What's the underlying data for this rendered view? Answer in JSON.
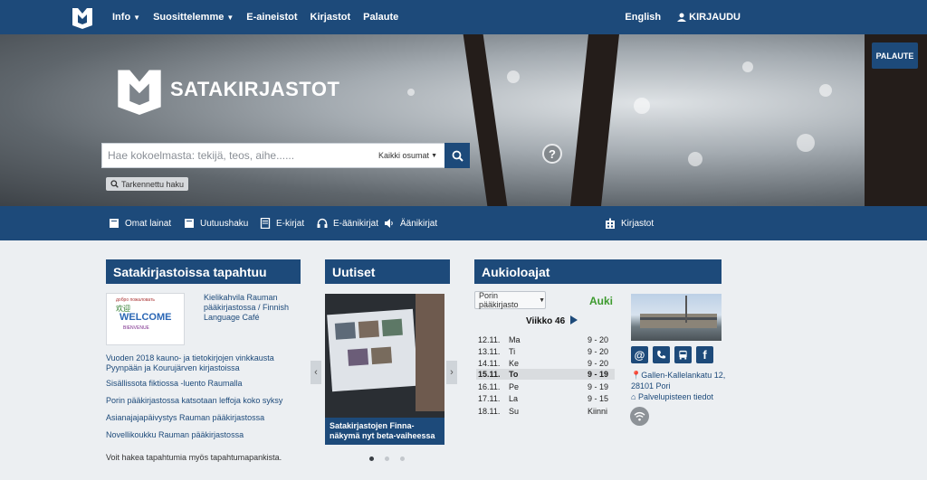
{
  "topbar": {
    "logo_icon": "satakirjastot-logo-icon",
    "nav": [
      {
        "label": "Info",
        "has_dropdown": true
      },
      {
        "label": "Suosittelemme",
        "has_dropdown": true
      },
      {
        "label": "E-aineistot",
        "has_dropdown": false
      },
      {
        "label": "Kirjastot",
        "has_dropdown": false
      },
      {
        "label": "Palaute",
        "has_dropdown": false
      }
    ],
    "language": "English",
    "login": "KIRJAUDU"
  },
  "hero": {
    "brand": "SATAKIRJASTOT",
    "search_placeholder": "Hae kokoelmasta: tekijä, teos, aihe......",
    "search_scope": "Kaikki osumat",
    "advanced_search": "Tarkennettu haku",
    "help": "?",
    "feedback_tab": "PALAUTE"
  },
  "quicklinks": [
    {
      "label": "Omat lainat",
      "icon": "book-icon"
    },
    {
      "label": "Uutuushaku",
      "icon": "book-icon"
    },
    {
      "label": "E-kirjat",
      "icon": "ebook-icon"
    },
    {
      "label": "E-äänikirjat",
      "icon": "headphones-icon"
    },
    {
      "label": "Äänikirjat",
      "icon": "speaker-icon"
    },
    {
      "label": "Kirjastot",
      "icon": "building-icon"
    }
  ],
  "events": {
    "heading": "Satakirjastoissa tapahtuu",
    "featured": "Kielikahvila Rauman pääkirjastossa / Finnish Language Café",
    "image_words": [
      "WELCOME",
      "欢迎",
      "BIENVENUE",
      "добро пожаловать"
    ],
    "items": [
      "Vuoden 2018 kauno- ja tietokirjojen vinkkausta Pyynpään ja Kourujärven kirjastoissa",
      "Sisällissota fiktiossa -luento Raumalla",
      "Porin pääkirjastossa katsotaan leffoja koko syksy",
      "Asianajajapäivystys Rauman pääkirjastossa",
      "Novellikoukku Rauman pääkirjastossa"
    ],
    "footer": "Voit hakea tapahtumia myös tapahtumapankista."
  },
  "news": {
    "heading": "Uutiset",
    "caption": "Satakirjastojen Finna-näkymä nyt beta-vaiheessa",
    "prev": "‹",
    "next": "›"
  },
  "hours": {
    "heading": "Aukioloajat",
    "library": "Porin pääkirjasto",
    "status": "Auki",
    "week": "Viikko 46",
    "rows": [
      {
        "date": "12.11.",
        "day": "Ma",
        "time": "9 - 20",
        "today": false
      },
      {
        "date": "13.11.",
        "day": "Ti",
        "time": "9 - 20",
        "today": false
      },
      {
        "date": "14.11.",
        "day": "Ke",
        "time": "9 - 20",
        "today": false
      },
      {
        "date": "15.11.",
        "day": "To",
        "time": "9 - 19",
        "today": true
      },
      {
        "date": "16.11.",
        "day": "Pe",
        "time": "9 - 19",
        "today": false
      },
      {
        "date": "17.11.",
        "day": "La",
        "time": "9 - 15",
        "today": false
      },
      {
        "date": "18.11.",
        "day": "Su",
        "time": "Kiinni",
        "today": false
      }
    ],
    "contacts": [
      "email-icon",
      "phone-icon",
      "bus-icon",
      "facebook-icon"
    ],
    "address_line1": "Gallen-Kallelankatu 12,",
    "address_line2": "28101 Pori",
    "service_link": "Palvelupisteen tiedot"
  },
  "colors": {
    "brand": "#1d4a7a",
    "open": "#3d9a2e"
  }
}
